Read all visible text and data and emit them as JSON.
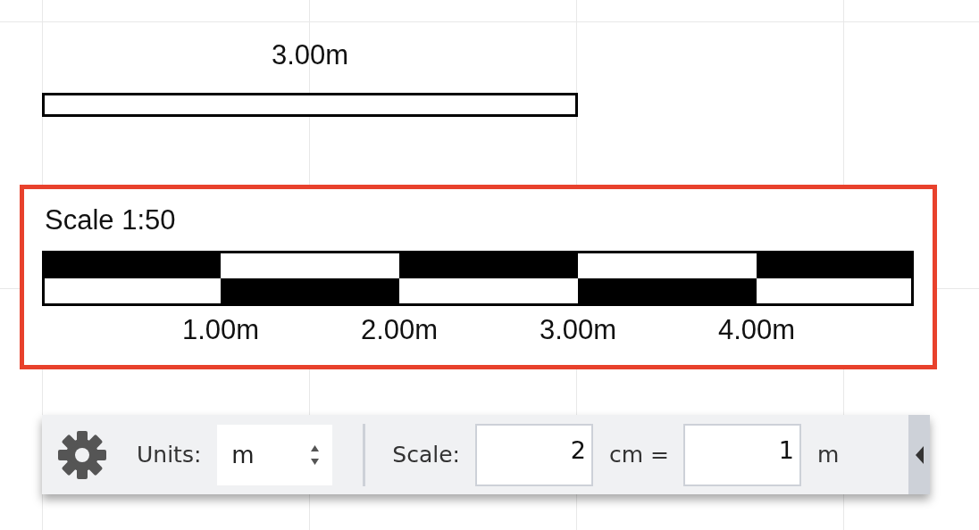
{
  "measurement": {
    "label": "3.00m"
  },
  "scale_bar": {
    "title": "Scale 1:50",
    "tick_labels": [
      "1.00m",
      "2.00m",
      "3.00m",
      "4.00m"
    ]
  },
  "toolbar": {
    "units": {
      "label": "Units:",
      "value": "m"
    },
    "scale": {
      "label": "Scale:",
      "paper_value": "2",
      "paper_unit": "cm =",
      "real_value": "1",
      "real_unit": "m"
    }
  }
}
